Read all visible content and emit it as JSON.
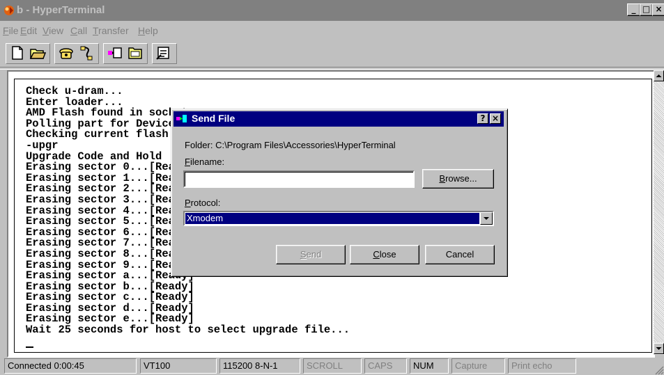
{
  "window": {
    "title": "b - HyperTerminal",
    "minimize_glyph": "_",
    "maximize_glyph": "□",
    "close_glyph": "×"
  },
  "menu": [
    {
      "label": "File"
    },
    {
      "label": "Edit"
    },
    {
      "label": "View"
    },
    {
      "label": "Call"
    },
    {
      "label": "Transfer"
    },
    {
      "label": "Help"
    }
  ],
  "toolbar": {
    "icons": [
      "new-document-icon",
      "open-folder-icon",
      "connect-phone-icon",
      "disconnect-phone-icon",
      "send-icon",
      "receive-icon",
      "properties-icon"
    ]
  },
  "terminal": {
    "lines": [
      "Check u-dram...",
      "Enter loader...",
      "AMD Flash found in socket",
      "Polling part for Device ID",
      "Checking current flash",
      "-upgr",
      "Upgrade Code and Hold",
      "Erasing sector 0...[Ready]",
      "Erasing sector 1...[Ready]",
      "Erasing sector 2...[Ready]",
      "Erasing sector 3...[Ready]",
      "Erasing sector 4...[Ready]",
      "Erasing sector 5...[Ready]",
      "Erasing sector 6...[Ready]",
      "Erasing sector 7...[Ready]",
      "Erasing sector 8...[Ready]",
      "Erasing sector 9...[Ready]",
      "Erasing sector a...[Ready]",
      "Erasing sector b...[Ready]",
      "Erasing sector c...[Ready]",
      "Erasing sector d...[Ready]",
      "Erasing sector e...[Ready]",
      "Wait 25 seconds for host to select upgrade file..."
    ]
  },
  "dialog": {
    "title": "Send File",
    "help_glyph": "?",
    "close_glyph": "×",
    "folder_text": "Folder:  C:\\Program Files\\Accessories\\HyperTerminal",
    "filename_label": "Filename:",
    "filename_value": "",
    "browse_label": "Browse...",
    "protocol_label": "Protocol:",
    "protocol_value": "Xmodem",
    "send_label": "Send",
    "close_label": "Close",
    "cancel_label": "Cancel"
  },
  "status": {
    "connected": "Connected 0:00:45",
    "emulation": "VT100",
    "settings": "115200 8-N-1",
    "scroll": "SCROLL",
    "caps": "CAPS",
    "num": "NUM",
    "capture": "Capture",
    "print_echo": "Print echo"
  }
}
